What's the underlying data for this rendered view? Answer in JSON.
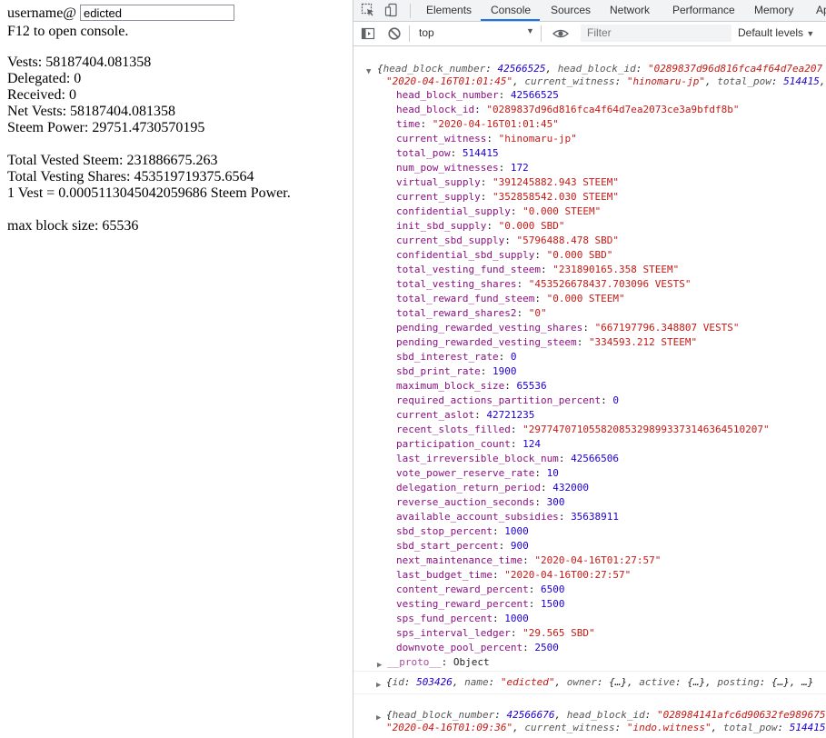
{
  "page": {
    "username_label": "username@",
    "username_value": "edicted",
    "hint": "F12 to open console.",
    "vests": "Vests: 58187404.081358",
    "delegated": "Delegated: 0",
    "received": "Received: 0",
    "net_vests": "Net Vests: 58187404.081358",
    "steem_power": "Steem Power: 29751.4730570195",
    "total_vested_steem": "Total Vested Steem: 231886675.263",
    "total_vesting_shares": "Total Vesting Shares: 453519719375.6564",
    "vest_ratio": "1 Vest = 0.0005113045042059686 Steem Power.",
    "max_block_size": "max block size: 65536"
  },
  "devtools": {
    "tabs": [
      "Elements",
      "Console",
      "Sources",
      "Network",
      "Performance",
      "Memory",
      "Ap"
    ],
    "active_tab": "Console",
    "context": "top",
    "filter_placeholder": "Filter",
    "levels": "Default levels",
    "msg1": {
      "preview": {
        "k1": "head_block_number",
        "v1": "42566525",
        "k2": "head_block_id",
        "v2": "\"0289837d96d816fca4f64d7ea207",
        "l2v": "\"2020-04-16T01:01:45\"",
        "k3": "current_witness",
        "v3": "\"hinomaru-jp\"",
        "k4": "total_pow",
        "v4": "514415"
      },
      "props": [
        {
          "k": "head_block_number",
          "v": "42566525",
          "t": "n"
        },
        {
          "k": "head_block_id",
          "v": "\"0289837d96d816fca4f64d7ea2073ce3a9bfdf8b\"",
          "t": "s"
        },
        {
          "k": "time",
          "v": "\"2020-04-16T01:01:45\"",
          "t": "s"
        },
        {
          "k": "current_witness",
          "v": "\"hinomaru-jp\"",
          "t": "s"
        },
        {
          "k": "total_pow",
          "v": "514415",
          "t": "n"
        },
        {
          "k": "num_pow_witnesses",
          "v": "172",
          "t": "n"
        },
        {
          "k": "virtual_supply",
          "v": "\"391245882.943 STEEM\"",
          "t": "s"
        },
        {
          "k": "current_supply",
          "v": "\"352858542.030 STEEM\"",
          "t": "s"
        },
        {
          "k": "confidential_supply",
          "v": "\"0.000 STEEM\"",
          "t": "s"
        },
        {
          "k": "init_sbd_supply",
          "v": "\"0.000 SBD\"",
          "t": "s"
        },
        {
          "k": "current_sbd_supply",
          "v": "\"5796488.478 SBD\"",
          "t": "s"
        },
        {
          "k": "confidential_sbd_supply",
          "v": "\"0.000 SBD\"",
          "t": "s"
        },
        {
          "k": "total_vesting_fund_steem",
          "v": "\"231890165.358 STEEM\"",
          "t": "s"
        },
        {
          "k": "total_vesting_shares",
          "v": "\"453526678437.703096 VESTS\"",
          "t": "s"
        },
        {
          "k": "total_reward_fund_steem",
          "v": "\"0.000 STEEM\"",
          "t": "s"
        },
        {
          "k": "total_reward_shares2",
          "v": "\"0\"",
          "t": "s"
        },
        {
          "k": "pending_rewarded_vesting_shares",
          "v": "\"667197796.348807 VESTS\"",
          "t": "s"
        },
        {
          "k": "pending_rewarded_vesting_steem",
          "v": "\"334593.212 STEEM\"",
          "t": "s"
        },
        {
          "k": "sbd_interest_rate",
          "v": "0",
          "t": "n"
        },
        {
          "k": "sbd_print_rate",
          "v": "1900",
          "t": "n"
        },
        {
          "k": "maximum_block_size",
          "v": "65536",
          "t": "n"
        },
        {
          "k": "required_actions_partition_percent",
          "v": "0",
          "t": "n"
        },
        {
          "k": "current_aslot",
          "v": "42721235",
          "t": "n"
        },
        {
          "k": "recent_slots_filled",
          "v": "\"297747071055820853298993373146364510207\"",
          "t": "s"
        },
        {
          "k": "participation_count",
          "v": "124",
          "t": "n"
        },
        {
          "k": "last_irreversible_block_num",
          "v": "42566506",
          "t": "n"
        },
        {
          "k": "vote_power_reserve_rate",
          "v": "10",
          "t": "n"
        },
        {
          "k": "delegation_return_period",
          "v": "432000",
          "t": "n"
        },
        {
          "k": "reverse_auction_seconds",
          "v": "300",
          "t": "n"
        },
        {
          "k": "available_account_subsidies",
          "v": "35638911",
          "t": "n"
        },
        {
          "k": "sbd_stop_percent",
          "v": "1000",
          "t": "n"
        },
        {
          "k": "sbd_start_percent",
          "v": "900",
          "t": "n"
        },
        {
          "k": "next_maintenance_time",
          "v": "\"2020-04-16T01:27:57\"",
          "t": "s"
        },
        {
          "k": "last_budget_time",
          "v": "\"2020-04-16T00:27:57\"",
          "t": "s"
        },
        {
          "k": "content_reward_percent",
          "v": "6500",
          "t": "n"
        },
        {
          "k": "vesting_reward_percent",
          "v": "1500",
          "t": "n"
        },
        {
          "k": "sps_fund_percent",
          "v": "1000",
          "t": "n"
        },
        {
          "k": "sps_interval_ledger",
          "v": "\"29.565 SBD\"",
          "t": "s"
        },
        {
          "k": "downvote_pool_percent",
          "v": "2500",
          "t": "n"
        }
      ],
      "proto_key": "__proto__",
      "proto_val": "Object"
    },
    "msg2": {
      "k1": "id",
      "v1": "503426",
      "k2": "name",
      "v2": "\"edicted\"",
      "k3": "owner",
      "k4": "active",
      "k5": "posting",
      "obj": "{…}",
      "ellipsis": "…"
    },
    "msg3": {
      "k1": "head_block_number",
      "v1": "42566676",
      "k2": "head_block_id",
      "v2": "\"028984141afc6d90632fe989675e",
      "l2v": "\"2020-04-16T01:09:36\"",
      "k3": "current_witness",
      "v3": "\"indo.witness\"",
      "k4": "total_pow",
      "v4": "514415"
    }
  }
}
